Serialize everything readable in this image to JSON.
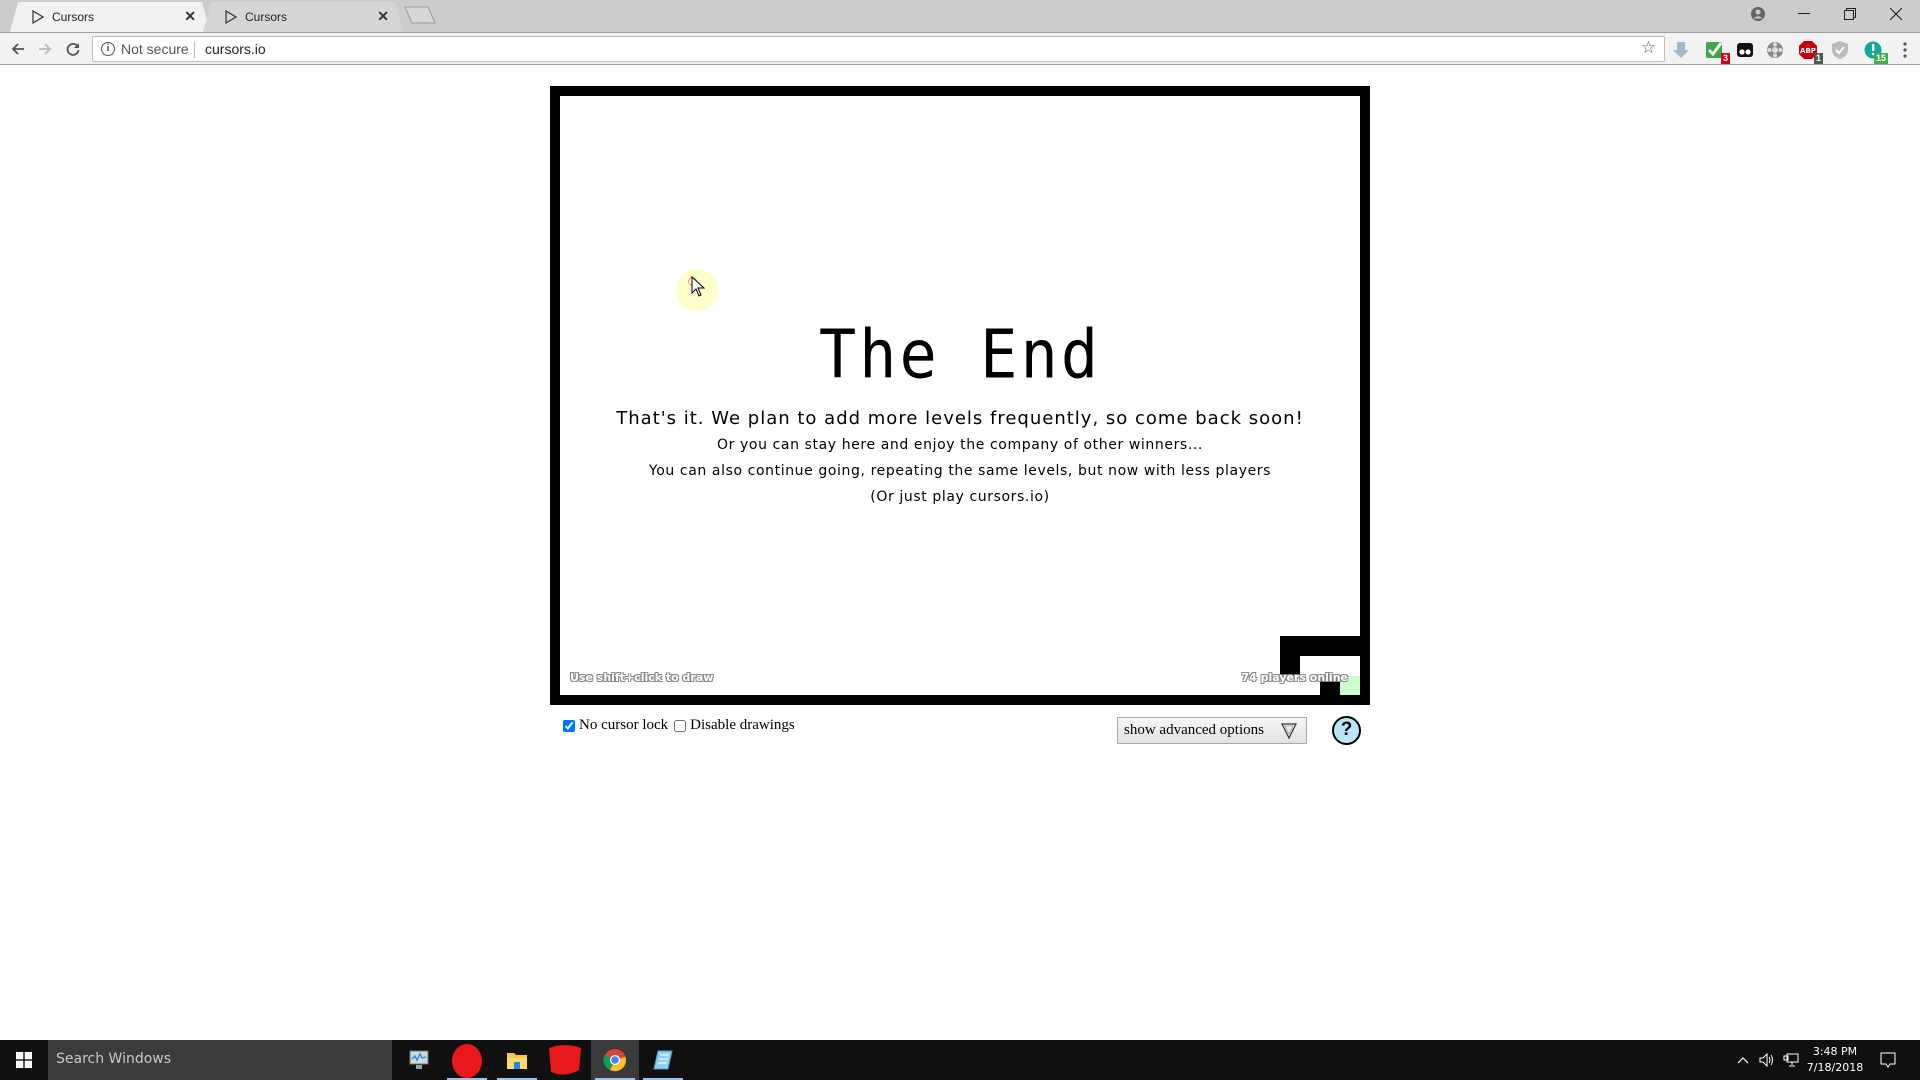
{
  "browser": {
    "tabs": [
      {
        "title": "Cursors",
        "active": true,
        "icon": "cursor-icon"
      },
      {
        "title": "Cursors",
        "active": false,
        "icon": "cursor-icon"
      }
    ],
    "security_label": "Not secure",
    "url": "cursors.io",
    "extensions": [
      {
        "name": "download-arrow-icon",
        "badge": ""
      },
      {
        "name": "checkmark-extension-icon",
        "badge": "3",
        "badge_color": "#d0021b"
      },
      {
        "name": "tampermonkey-icon",
        "badge": ""
      },
      {
        "name": "film-reel-icon",
        "badge": ""
      },
      {
        "name": "adblock-plus-icon",
        "badge": "1",
        "badge_color": "#555555"
      },
      {
        "name": "shield-icon",
        "badge": ""
      },
      {
        "name": "grammarly-icon",
        "badge": "15",
        "badge_color": "#3fae49"
      }
    ]
  },
  "game": {
    "title": "The End",
    "line1": "That's it. We plan to add more levels frequently, so come back soon!",
    "line2": "Or you can stay here and enjoy the company of other winners...",
    "line3": "You can also continue going, repeating the same levels, but now with less players",
    "line4": "(Or just play cursors.io)",
    "hint": "Use shift+click to draw",
    "players_online": "74 players online",
    "goal_color": "#ccffcc"
  },
  "options": {
    "no_cursor_lock_label": "No cursor lock",
    "no_cursor_lock_checked": true,
    "disable_drawings_label": "Disable drawings",
    "disable_drawings_checked": false,
    "advanced_button_label": "show advanced options",
    "help_label": "?"
  },
  "taskbar": {
    "search_placeholder": "Search Windows",
    "apps": [
      "resource-monitor-icon",
      "redacted-app-icon",
      "file-explorer-icon",
      "redacted-app-icon",
      "chrome-icon",
      "notepad-icon"
    ],
    "active_app": "chrome-icon",
    "time": "3:48 PM",
    "date": "7/18/2018"
  }
}
